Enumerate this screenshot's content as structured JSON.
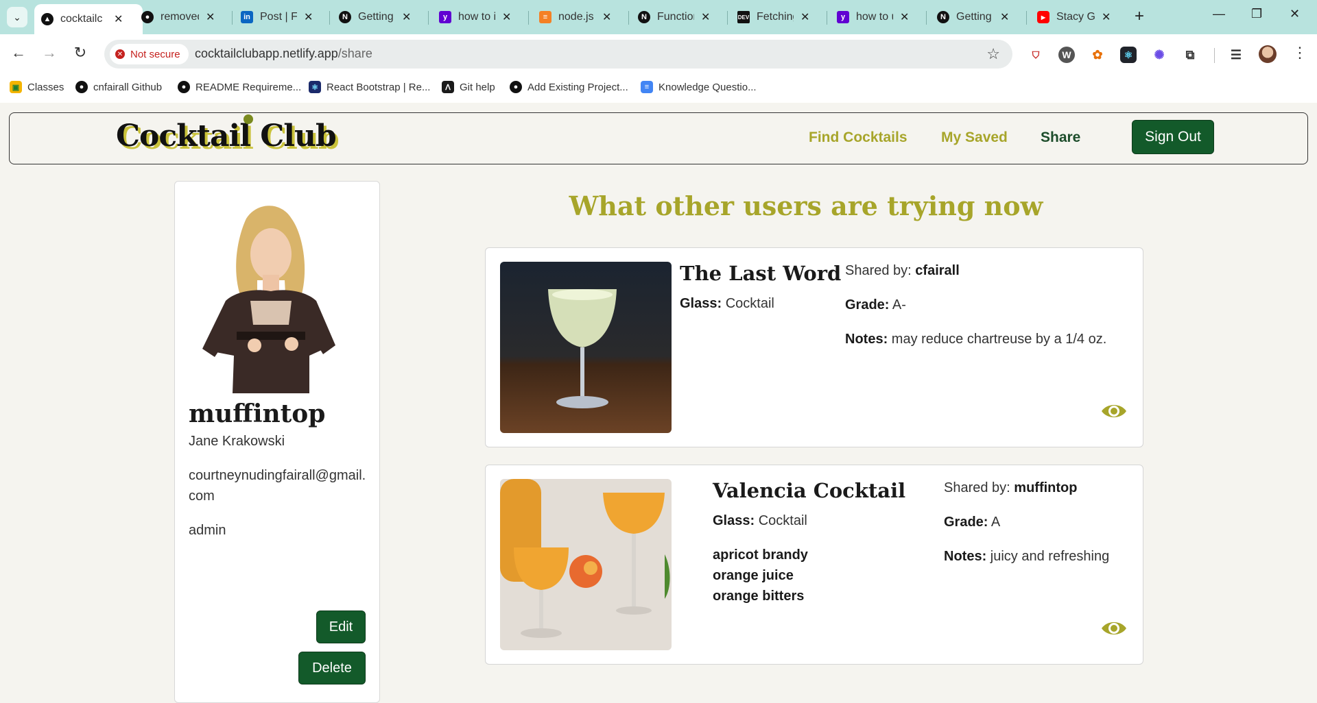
{
  "browser": {
    "tabs": [
      {
        "title": "cocktailc",
        "icon": "netlify-triangle-icon",
        "active": true
      },
      {
        "title": "removed",
        "icon": "github-icon"
      },
      {
        "title": "Post | Fe",
        "icon": "linkedin-icon"
      },
      {
        "title": "Getting",
        "icon": "nextjs-icon"
      },
      {
        "title": "how to i",
        "icon": "yahoo-icon"
      },
      {
        "title": "node.js",
        "icon": "stackoverflow-icon"
      },
      {
        "title": "Function",
        "icon": "nextjs-icon"
      },
      {
        "title": "Fetching",
        "icon": "dev-icon"
      },
      {
        "title": "how to u",
        "icon": "yahoo-icon"
      },
      {
        "title": "Getting",
        "icon": "nextjs-icon"
      },
      {
        "title": "Stacy Gr",
        "icon": "youtube-icon"
      }
    ],
    "security_label": "Not secure",
    "url_host": "cocktailclubapp.netlify.app",
    "url_path": "/share",
    "bookmarks": [
      {
        "label": "Classes",
        "icon": "google-classroom-icon"
      },
      {
        "label": "cnfairall Github",
        "icon": "github-icon"
      },
      {
        "label": "README Requireme...",
        "icon": "github-icon"
      },
      {
        "label": "React Bootstrap | Re...",
        "icon": "react-bootstrap-icon"
      },
      {
        "label": "Git help",
        "icon": "bookmark-icon"
      },
      {
        "label": "Add Existing Project...",
        "icon": "github-icon"
      },
      {
        "label": "Knowledge Questio...",
        "icon": "google-docs-icon"
      }
    ]
  },
  "site": {
    "logo": "Cocktail Club",
    "nav": [
      {
        "label": "Find Cocktails"
      },
      {
        "label": "My Saved"
      },
      {
        "label": "Share",
        "active": true
      }
    ],
    "sign_out": "Sign Out"
  },
  "profile": {
    "username": "muffintop",
    "full_name": "Jane Krakowski",
    "email": "courtneynudingfairall@gmail.com",
    "role": "admin",
    "edit_label": "Edit",
    "delete_label": "Delete"
  },
  "heading": "What other users are trying now",
  "cards": [
    {
      "name": "The Last Word",
      "glass_label": "Glass:",
      "glass": "Cocktail",
      "shared_label": "Shared by:",
      "shared_by": "cfairall",
      "grade_label": "Grade:",
      "grade": "A-",
      "notes_label": "Notes:",
      "notes": "may reduce chartreuse by a 1/4 oz.",
      "ingredients": []
    },
    {
      "name": "Valencia Cocktail",
      "glass_label": "Glass:",
      "glass": "Cocktail",
      "shared_label": "Shared by:",
      "shared_by": "muffintop",
      "grade_label": "Grade:",
      "grade": "A",
      "notes_label": "Notes:",
      "notes": "juicy and refreshing",
      "ingredients": [
        "apricot brandy",
        "orange juice",
        "orange bitters"
      ]
    }
  ],
  "colors": {
    "accent_olive": "#a7a52a",
    "button_green": "#135a2a",
    "page_bg": "#f5f4ef",
    "tab_strip": "#b8e3de"
  }
}
